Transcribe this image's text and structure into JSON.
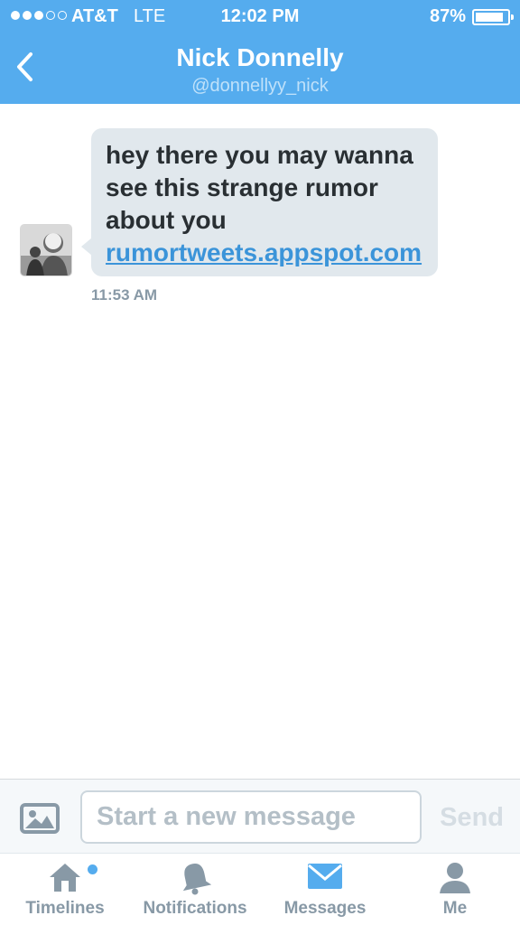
{
  "status_bar": {
    "carrier": "AT&T",
    "network": "LTE",
    "time": "12:02 PM",
    "battery": "87%",
    "battery_level": 0.87,
    "signal_bars": 3,
    "signal_total": 5
  },
  "nav": {
    "back_icon": "chevron-left-icon",
    "title": "Nick Donnelly",
    "subtitle": "@donnellyy_nick"
  },
  "messages": [
    {
      "text_lines": [
        "hey there you may wanna",
        "see this strange rumor",
        "about you"
      ],
      "link": "rumortweets.appspot.com",
      "time": "11:53 AM",
      "avatar_icon": "user-avatar"
    }
  ],
  "composer": {
    "photo_icon": "image-icon",
    "placeholder": "Start a new message",
    "value": "",
    "send_label": "Send"
  },
  "tab_bar": {
    "tabs": [
      {
        "label": "Timelines",
        "icon": "home-icon",
        "active": false,
        "badge": true
      },
      {
        "label": "Notifications",
        "icon": "bell-icon",
        "active": false,
        "badge": false
      },
      {
        "label": "Messages",
        "icon": "envelope-icon",
        "active": true,
        "badge": false
      },
      {
        "label": "Me",
        "icon": "person-icon",
        "active": false,
        "badge": false
      }
    ]
  },
  "colors": {
    "brand": "#55acee",
    "bubble": "#e1e8ed",
    "link": "#3b94d9",
    "muted": "#8899a6"
  }
}
